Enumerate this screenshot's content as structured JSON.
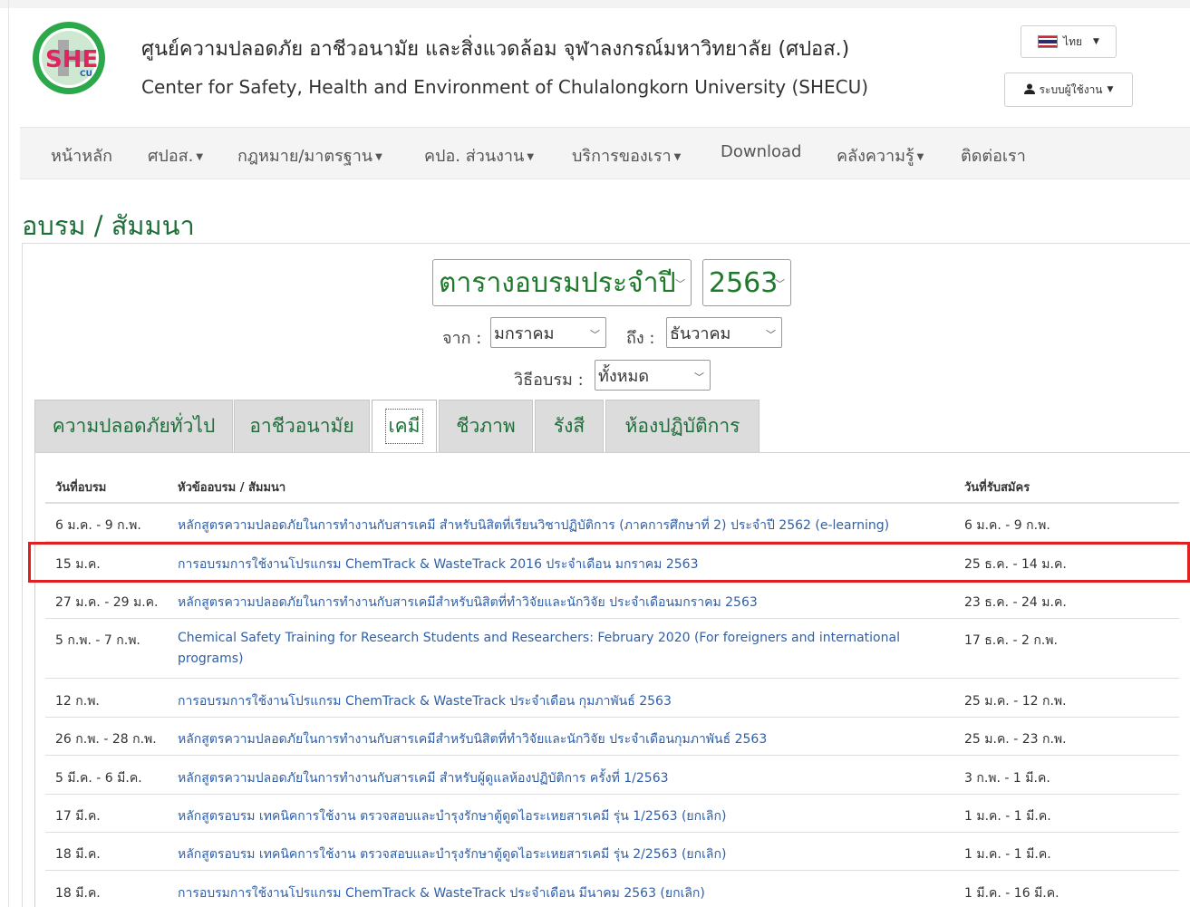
{
  "header": {
    "title_th": "ศูนย์ความปลอดภัย อาชีวอนามัย และสิ่งแวดล้อม จุฬาลงกรณ์มหาวิทยาลัย (ศปอส.)",
    "title_en": "Center for Safety, Health and Environment of Chulalongkorn University (SHECU)",
    "logo_text": "SHE",
    "logo_sub": "CU",
    "lang_label": "ไทย",
    "user_menu_label": "ระบบผู้ใช้งาน"
  },
  "nav": {
    "items": [
      {
        "label": "หน้าหลัก",
        "dropdown": false
      },
      {
        "label": "ศปอส.",
        "dropdown": true
      },
      {
        "label": "กฎหมาย/มาตรฐาน",
        "dropdown": true
      },
      {
        "label": "คปอ. ส่วนงาน",
        "dropdown": true
      },
      {
        "label": "บริการของเรา",
        "dropdown": true
      },
      {
        "label": "Download",
        "dropdown": false
      },
      {
        "label": "คลังความรู้",
        "dropdown": true
      },
      {
        "label": "ติดต่อเรา",
        "dropdown": false
      }
    ]
  },
  "page": {
    "title": "อบรม / สัมมนา"
  },
  "filters": {
    "schedule_type": "ตารางอบรมประจำปี",
    "year": "2563",
    "from_label": "จาก :",
    "from_value": "มกราคม",
    "to_label": "ถึง :",
    "to_value": "ธันวาคม",
    "method_label": "วิธีอบรม :",
    "method_value": "ทั้งหมด"
  },
  "tabs": [
    {
      "label": "ความปลอดภัยทั่วไป",
      "active": false
    },
    {
      "label": "อาชีวอนามัย",
      "active": false
    },
    {
      "label": "เคมี",
      "active": true
    },
    {
      "label": "ชีวภาพ",
      "active": false
    },
    {
      "label": "รังสี",
      "active": false
    },
    {
      "label": "ห้องปฏิบัติการ",
      "active": false
    }
  ],
  "table": {
    "headers": {
      "date": "วันที่อบรม",
      "topic": "หัวข้ออบรม / สัมมนา",
      "register": "วันที่รับสมัคร"
    },
    "rows": [
      {
        "date": "6 ม.ค. - 9 ก.พ.",
        "topic": "หลักสูตรความปลอดภัยในการทำงานกับสารเคมี สำหรับนิสิตที่เรียนวิชาปฏิบัติการ (ภาคการศึกษาที่ 2) ประจำปี 2562 (e-learning)",
        "register": "6 ม.ค. - 9 ก.พ."
      },
      {
        "date": "15 ม.ค.",
        "topic": "การอบรมการใช้งานโปรแกรม ChemTrack & WasteTrack 2016 ประจำเดือน มกราคม 2563",
        "register": "25 ธ.ค. - 14 ม.ค."
      },
      {
        "date": "27 ม.ค. - 29 ม.ค.",
        "topic": "หลักสูตรความปลอดภัยในการทำงานกับสารเคมีสำหรับนิสิตที่ทำวิจัยและนักวิจัย ประจำเดือนมกราคม 2563",
        "register": "23 ธ.ค. - 24 ม.ค."
      },
      {
        "date": "5 ก.พ. - 7 ก.พ.",
        "topic": "Chemical Safety Training for Research Students and Researchers: February 2020 (For foreigners and international programs)",
        "register": "17 ธ.ค. - 2 ก.พ."
      },
      {
        "date": "12 ก.พ.",
        "topic": "การอบรมการใช้งานโปรแกรม ChemTrack & WasteTrack  ประจำเดือน  กุมภาพันธ์ 2563",
        "register": "25 ม.ค. - 12 ก.พ."
      },
      {
        "date": "26 ก.พ. - 28 ก.พ.",
        "topic": "หลักสูตรความปลอดภัยในการทำงานกับสารเคมีสำหรับนิสิตที่ทำวิจัยและนักวิจัย ประจำเดือนกุมภาพันธ์ 2563",
        "register": "25 ม.ค. - 23 ก.พ."
      },
      {
        "date": "5 มี.ค. - 6 มี.ค.",
        "topic": "หลักสูตรความปลอดภัยในการทำงานกับสารเคมี สำหรับผู้ดูแลห้องปฏิบัติการ ครั้งที่ 1/2563",
        "register": "3 ก.พ. - 1 มี.ค."
      },
      {
        "date": "17 มี.ค.",
        "topic": "หลักสูตรอบรม เทคนิคการใช้งาน ตรวจสอบและบำรุงรักษาตู้ดูดไอระเหยสารเคมี รุ่น 1/2563 (ยกเลิก)",
        "register": "1 ม.ค. - 1 มี.ค."
      },
      {
        "date": "18 มี.ค.",
        "topic": "หลักสูตรอบรม เทคนิคการใช้งาน ตรวจสอบและบำรุงรักษาตู้ดูดไอระเหยสารเคมี รุ่น 2/2563 (ยกเลิก)",
        "register": "1 ม.ค. - 1 มี.ค."
      },
      {
        "date": "18 มี.ค.",
        "topic": "การอบรมการใช้งานโปรแกรม ChemTrack & WasteTrack  ประจำเดือน  มีนาคม 2563  (ยกเลิก)",
        "register": "1 มี.ค. - 16 มี.ค."
      }
    ]
  },
  "colors": {
    "brand_green": "#1e6e3a",
    "link_blue": "#2e5fa8",
    "highlight_red": "#e02020"
  }
}
